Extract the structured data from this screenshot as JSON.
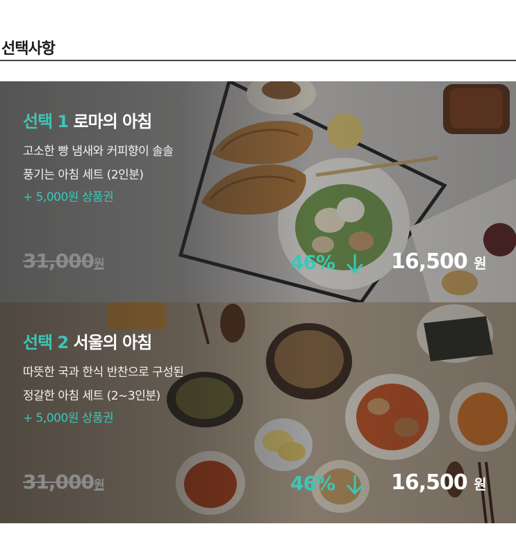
{
  "header": {
    "title": "선택사항"
  },
  "options": [
    {
      "label_prefix": "선택 1",
      "name": "로마의 아침",
      "desc_line1": "고소한 빵 냄새와 커피향이 솔솔",
      "desc_line2": "풍기는 아침 세트 (2인분)",
      "voucher": "+ 5,000원 상품권",
      "original_price": "31,000",
      "original_unit": "원",
      "discount": "46%",
      "sale_price": "16,500",
      "sale_unit": "원",
      "arrow_icon": "down-arrow-icon"
    },
    {
      "label_prefix": "선택 2",
      "name": "서울의 아침",
      "desc_line1": "따뜻한 국과 한식 반찬으로 구성된",
      "desc_line2": "정갈한 아침 세트 (2~3인분)",
      "voucher": "+ 5,000원 상품권",
      "original_price": "31,000",
      "original_unit": "원",
      "discount": "46%",
      "sale_price": "16,500",
      "sale_unit": "원",
      "arrow_icon": "down-arrow-icon"
    }
  ],
  "colors": {
    "accent": "#3cc6b8",
    "strike_price": "#8b8b8b",
    "divider": "#444444"
  }
}
